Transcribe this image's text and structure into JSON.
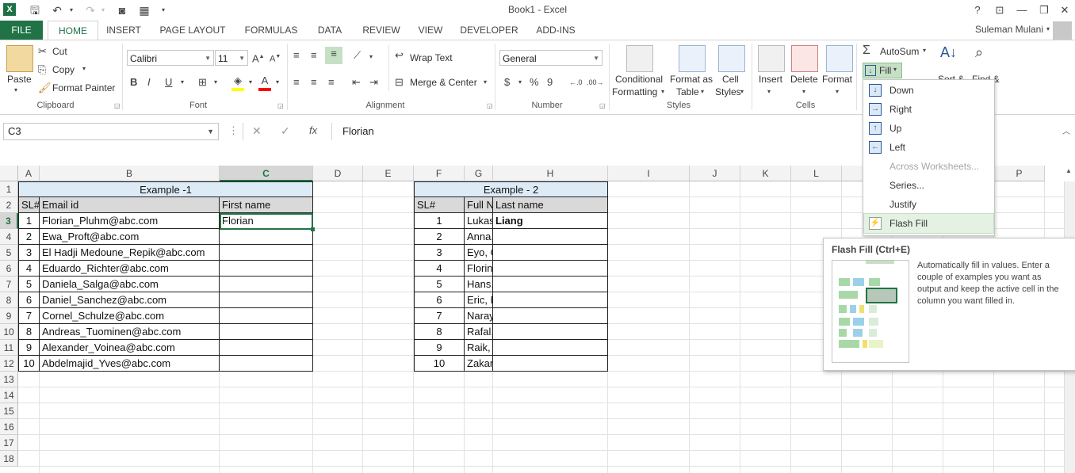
{
  "window": {
    "title": "Book1 - Excel",
    "user": "Suleman Mulani",
    "help": "?",
    "minimize": "—",
    "restore": "❐",
    "close": "✕",
    "ribbon_display": "⊡"
  },
  "tabs": [
    "FILE",
    "HOME",
    "INSERT",
    "PAGE LAYOUT",
    "FORMULAS",
    "DATA",
    "REVIEW",
    "VIEW",
    "DEVELOPER",
    "ADD-INS"
  ],
  "ribbon": {
    "clipboard": {
      "paste": "Paste",
      "cut": "Cut",
      "copy": "Copy",
      "format_painter": "Format Painter",
      "label": "Clipboard"
    },
    "font": {
      "name": "Calibri",
      "size": "11",
      "bold": "B",
      "italic": "I",
      "underline": "U",
      "label": "Font"
    },
    "alignment": {
      "wrap": "Wrap Text",
      "merge": "Merge & Center",
      "label": "Alignment"
    },
    "number": {
      "format": "General",
      "currency": "$",
      "percent": "%",
      "comma": "9",
      "label": "Number"
    },
    "styles": {
      "conditional": "Conditional",
      "conditional2": "Formatting",
      "format_as": "Format as",
      "format_as2": "Table",
      "cell": "Cell",
      "cell2": "Styles",
      "label": "Styles"
    },
    "cells": {
      "insert": "Insert",
      "delete": "Delete",
      "format": "Format",
      "label": "Cells"
    },
    "editing": {
      "autosum": "AutoSum",
      "fill": "Fill",
      "sort": "Sort &",
      "find": "Find &"
    }
  },
  "formula_bar": {
    "name_box": "C3",
    "content": "Florian",
    "fx": "fx"
  },
  "columns": [
    "A",
    "B",
    "C",
    "D",
    "E",
    "F",
    "G",
    "H",
    "I",
    "J",
    "K",
    "L",
    "M",
    "N",
    "O",
    "P"
  ],
  "rows": [
    "1",
    "2",
    "3",
    "4",
    "5",
    "6",
    "7",
    "8",
    "9",
    "10",
    "11",
    "12",
    "13",
    "14",
    "15",
    "16",
    "17",
    "18"
  ],
  "example1": {
    "title": "Example -1",
    "headers": [
      "SL#",
      "Email id",
      "First name"
    ],
    "rows": [
      [
        "1",
        "Florian_Pluhm@abc.com",
        "Florian"
      ],
      [
        "2",
        "Ewa_Proft@abc.com",
        ""
      ],
      [
        "3",
        "El Hadji Medoune_Repik@abc.com",
        ""
      ],
      [
        "4",
        "Eduardo_Richter@abc.com",
        ""
      ],
      [
        "5",
        "Daniela_Salga@abc.com",
        ""
      ],
      [
        "6",
        "Daniel_Sanchez@abc.com",
        ""
      ],
      [
        "7",
        "Cornel_Schulze@abc.com",
        ""
      ],
      [
        "8",
        "Andreas_Tuominen@abc.com",
        ""
      ],
      [
        "9",
        "Alexander_Voinea@abc.com",
        ""
      ],
      [
        "10",
        "Abdelmajid_Yves@abc.com",
        ""
      ]
    ]
  },
  "example2": {
    "title": "Example - 2",
    "headers": [
      "SL#",
      "Full Name",
      "Last name"
    ],
    "rows": [
      [
        "1",
        "Lukasz, Liang",
        "Liang"
      ],
      [
        "2",
        "Anna, Berndt",
        ""
      ],
      [
        "3",
        "Eyo, Gallorini",
        ""
      ],
      [
        "4",
        "Florin, Gojnea",
        ""
      ],
      [
        "5",
        "Hans, Hashem",
        ""
      ],
      [
        "6",
        "Eric, Franke",
        ""
      ],
      [
        "7",
        "Narayana, Ntoa",
        ""
      ],
      [
        "8",
        "Rafal, Reid",
        ""
      ],
      [
        "9",
        "Raik, Reilly",
        ""
      ],
      [
        "10",
        "Zakaria, Zoughi",
        ""
      ]
    ]
  },
  "fill_menu": [
    {
      "label": "Down",
      "icon": "↓",
      "enabled": true
    },
    {
      "label": "Right",
      "icon": "→",
      "enabled": true
    },
    {
      "label": "Up",
      "icon": "↑",
      "enabled": true
    },
    {
      "label": "Left",
      "icon": "←",
      "enabled": true
    },
    {
      "label": "Across Worksheets...",
      "icon": "",
      "enabled": false
    },
    {
      "label": "Series...",
      "icon": "",
      "enabled": true
    },
    {
      "label": "Justify",
      "icon": "",
      "enabled": true
    },
    {
      "label": "Flash Fill",
      "icon": "⚡",
      "enabled": true,
      "highlighted": true
    }
  ],
  "tooltip": {
    "title": "Flash Fill (Ctrl+E)",
    "body": "Automatically fill in values. Enter a couple of examples you want as output and keep the active cell in the column you want filled in."
  },
  "colors": {
    "excel_green": "#217346",
    "header_blue": "#ddebf7",
    "header_gray": "#d9d9d9",
    "highlight": "#e3f2e3"
  }
}
